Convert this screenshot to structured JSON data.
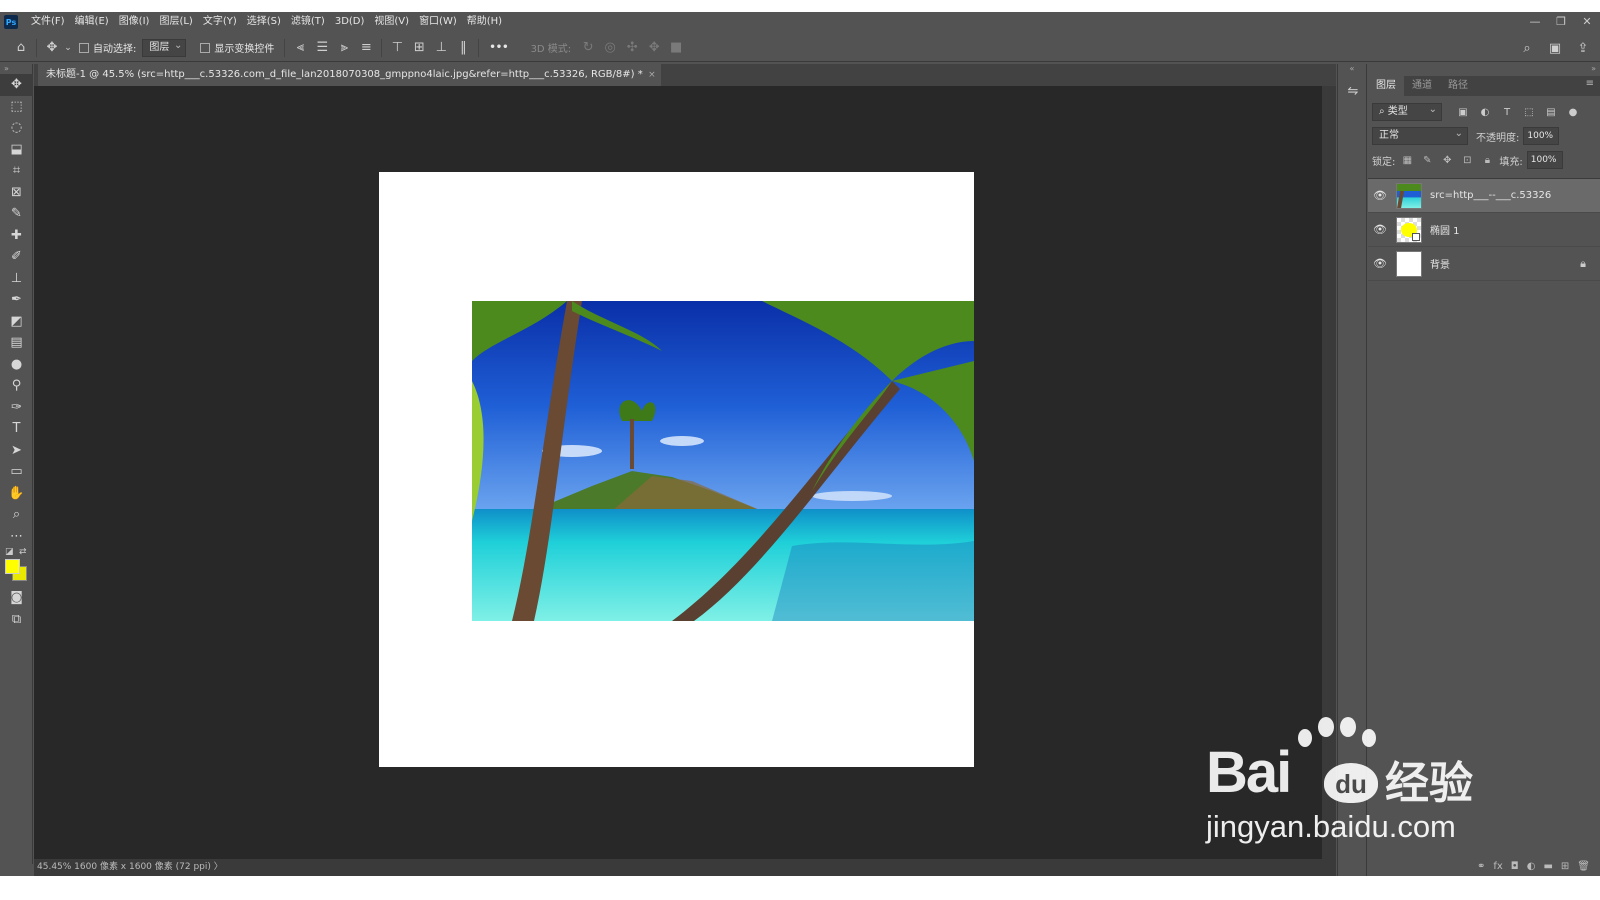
{
  "app": {
    "logo": "Ps",
    "menu": [
      "文件(F)",
      "编辑(E)",
      "图像(I)",
      "图层(L)",
      "文字(Y)",
      "选择(S)",
      "滤镜(T)",
      "3D(D)",
      "视图(V)",
      "窗口(W)",
      "帮助(H)"
    ],
    "window_controls": [
      "—",
      "❐",
      "✕"
    ]
  },
  "options_bar": {
    "auto_select_label": "自动选择:",
    "auto_select_value": "图层",
    "show_transform_label": "显示变换控件",
    "more": "•••",
    "mode_3d_label": "3D 模式:"
  },
  "document": {
    "tab_title": "未标题-1 @ 45.5% (src=http___c.53326.com_d_file_lan2018070308_gmppno4laic.jpg&refer=http___c.53326, RGB/8#) *",
    "close": "×",
    "status": "45.45%   1600 像素 x 1600 像素 (72 ppi)   〉"
  },
  "colors": {
    "foreground": "#ffff00",
    "background": "#e8e800",
    "canvas_bg": "#282828",
    "ui_panel": "#535353"
  },
  "layers_panel": {
    "tabs": [
      "图层",
      "通道",
      "路径"
    ],
    "filter_label": "类型",
    "blend_mode": "正常",
    "opacity_label": "不透明度:",
    "opacity_value": "100%",
    "lock_label": "锁定:",
    "fill_label": "填充:",
    "fill_value": "100%",
    "layers": [
      {
        "name": "src=http___--___c.53326",
        "selected": true,
        "thumb": "photo"
      },
      {
        "name": "椭圆 1",
        "selected": false,
        "thumb": "shape"
      },
      {
        "name": "背景",
        "selected": false,
        "thumb": "white",
        "locked": true
      }
    ]
  },
  "watermark": {
    "bai": "Bai",
    "du": "du",
    "jingyan": "经验",
    "url": "jingyan.baidu.com"
  }
}
